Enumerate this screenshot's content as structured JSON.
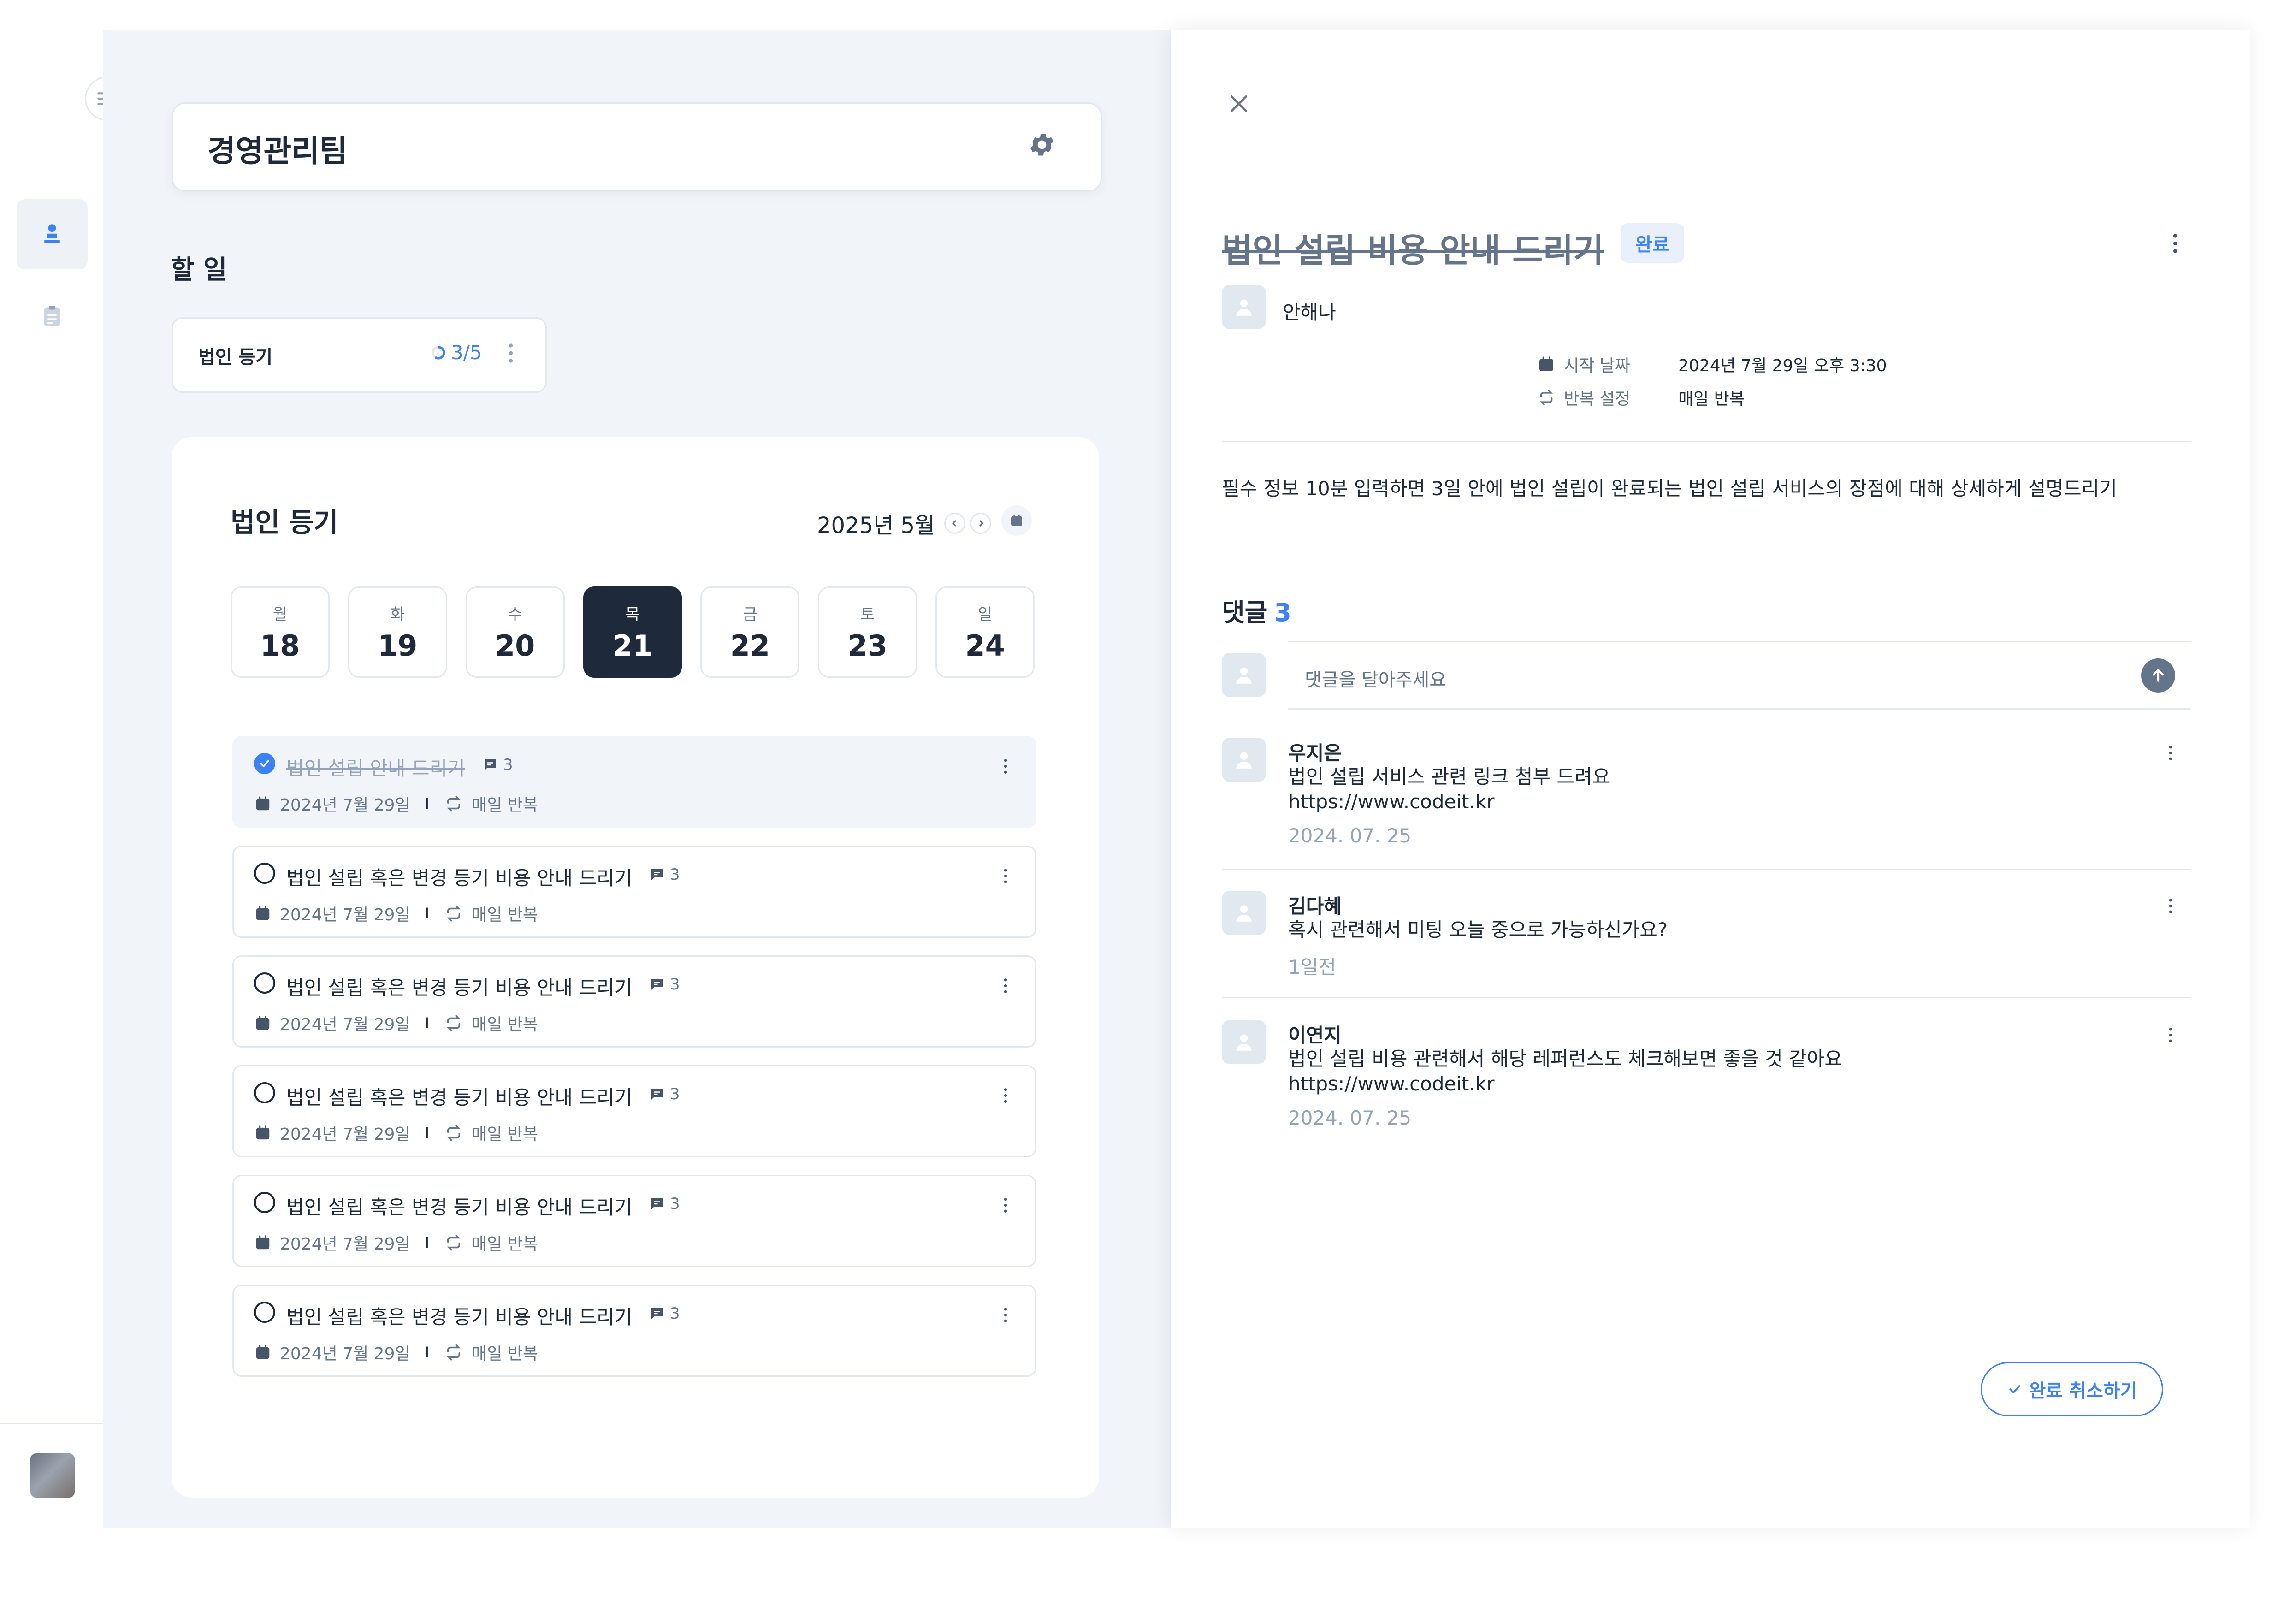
{
  "team": {
    "name": "경영관리팀"
  },
  "todo_section": {
    "title": "할 일"
  },
  "task_lists": [
    {
      "name": "법인 등기",
      "progress": "3/5",
      "progress_fraction": 0.6
    }
  ],
  "panel": {
    "title": "법인 등기",
    "month_label": "2025년 5월"
  },
  "week": [
    {
      "weekday": "월",
      "date": "18"
    },
    {
      "weekday": "화",
      "date": "19"
    },
    {
      "weekday": "수",
      "date": "20"
    },
    {
      "weekday": "목",
      "date": "21",
      "selected": true
    },
    {
      "weekday": "금",
      "date": "22"
    },
    {
      "weekday": "토",
      "date": "23"
    },
    {
      "weekday": "일",
      "date": "24"
    }
  ],
  "tasks": [
    {
      "name": "법인 설립 안내 드리기",
      "comments": "3",
      "date": "2024년 7월 29일",
      "repeat": "매일 반복",
      "done": true
    },
    {
      "name": "법인 설립 혹은 변경 등기 비용 안내 드리기",
      "comments": "3",
      "date": "2024년 7월 29일",
      "repeat": "매일 반복",
      "done": false
    },
    {
      "name": "법인 설립 혹은 변경 등기 비용 안내 드리기",
      "comments": "3",
      "date": "2024년 7월 29일",
      "repeat": "매일 반복",
      "done": false
    },
    {
      "name": "법인 설립 혹은 변경 등기 비용 안내 드리기",
      "comments": "3",
      "date": "2024년 7월 29일",
      "repeat": "매일 반복",
      "done": false
    },
    {
      "name": "법인 설립 혹은 변경 등기 비용 안내 드리기",
      "comments": "3",
      "date": "2024년 7월 29일",
      "repeat": "매일 반복",
      "done": false
    },
    {
      "name": "법인 설립 혹은 변경 등기 비용 안내 드리기",
      "comments": "3",
      "date": "2024년 7월 29일",
      "repeat": "매일 반복",
      "done": false
    }
  ],
  "detail": {
    "title": "법인 설립 비용 안내 드리기",
    "status_badge": "완료",
    "author": "안해나",
    "start_label": "시작 날짜",
    "start_value": "2024년 7월 29일 오후 3:30",
    "repeat_label": "반복 설정",
    "repeat_value": "매일 반복",
    "description": "필수 정보 10분 입력하면 3일 안에 법인 설립이 완료되는 법인 설립 서비스의 장점에 대해 상세하게 설명드리기",
    "comments_title": "댓글",
    "comments_count": "3",
    "comment_placeholder": "댓글을 달아주세요",
    "comments": [
      {
        "author": "우지은",
        "lines": [
          "법인 설립 서비스 관련 링크 첨부 드려요",
          "https://www.codeit.kr"
        ],
        "time": "2024. 07. 25"
      },
      {
        "author": "김다혜",
        "lines": [
          "혹시 관련해서 미팅 오늘 중으로 가능하신가요?"
        ],
        "time": "1일전"
      },
      {
        "author": "이연지",
        "lines": [
          "법인 설립 비용 관련해서 해당 레퍼런스도 체크해보면 좋을 것 같아요",
          "https://www.codeit.kr"
        ],
        "time": "2024. 07. 25"
      }
    ],
    "undo_button": "완료 취소하기"
  },
  "colors": {
    "accent": "#3b82f6",
    "dark": "#1e293b",
    "muted": "#64748b",
    "background": "#f1f4f9"
  },
  "icons": [
    "collapse-sidebar-icon",
    "user-icon",
    "clipboard-icon",
    "gear-icon",
    "progress-ring-icon",
    "kebab-icon",
    "chevron-left-icon",
    "chevron-right-icon",
    "calendar-icon",
    "check-icon",
    "comment-icon",
    "repeat-icon",
    "close-icon",
    "send-arrow-icon"
  ]
}
